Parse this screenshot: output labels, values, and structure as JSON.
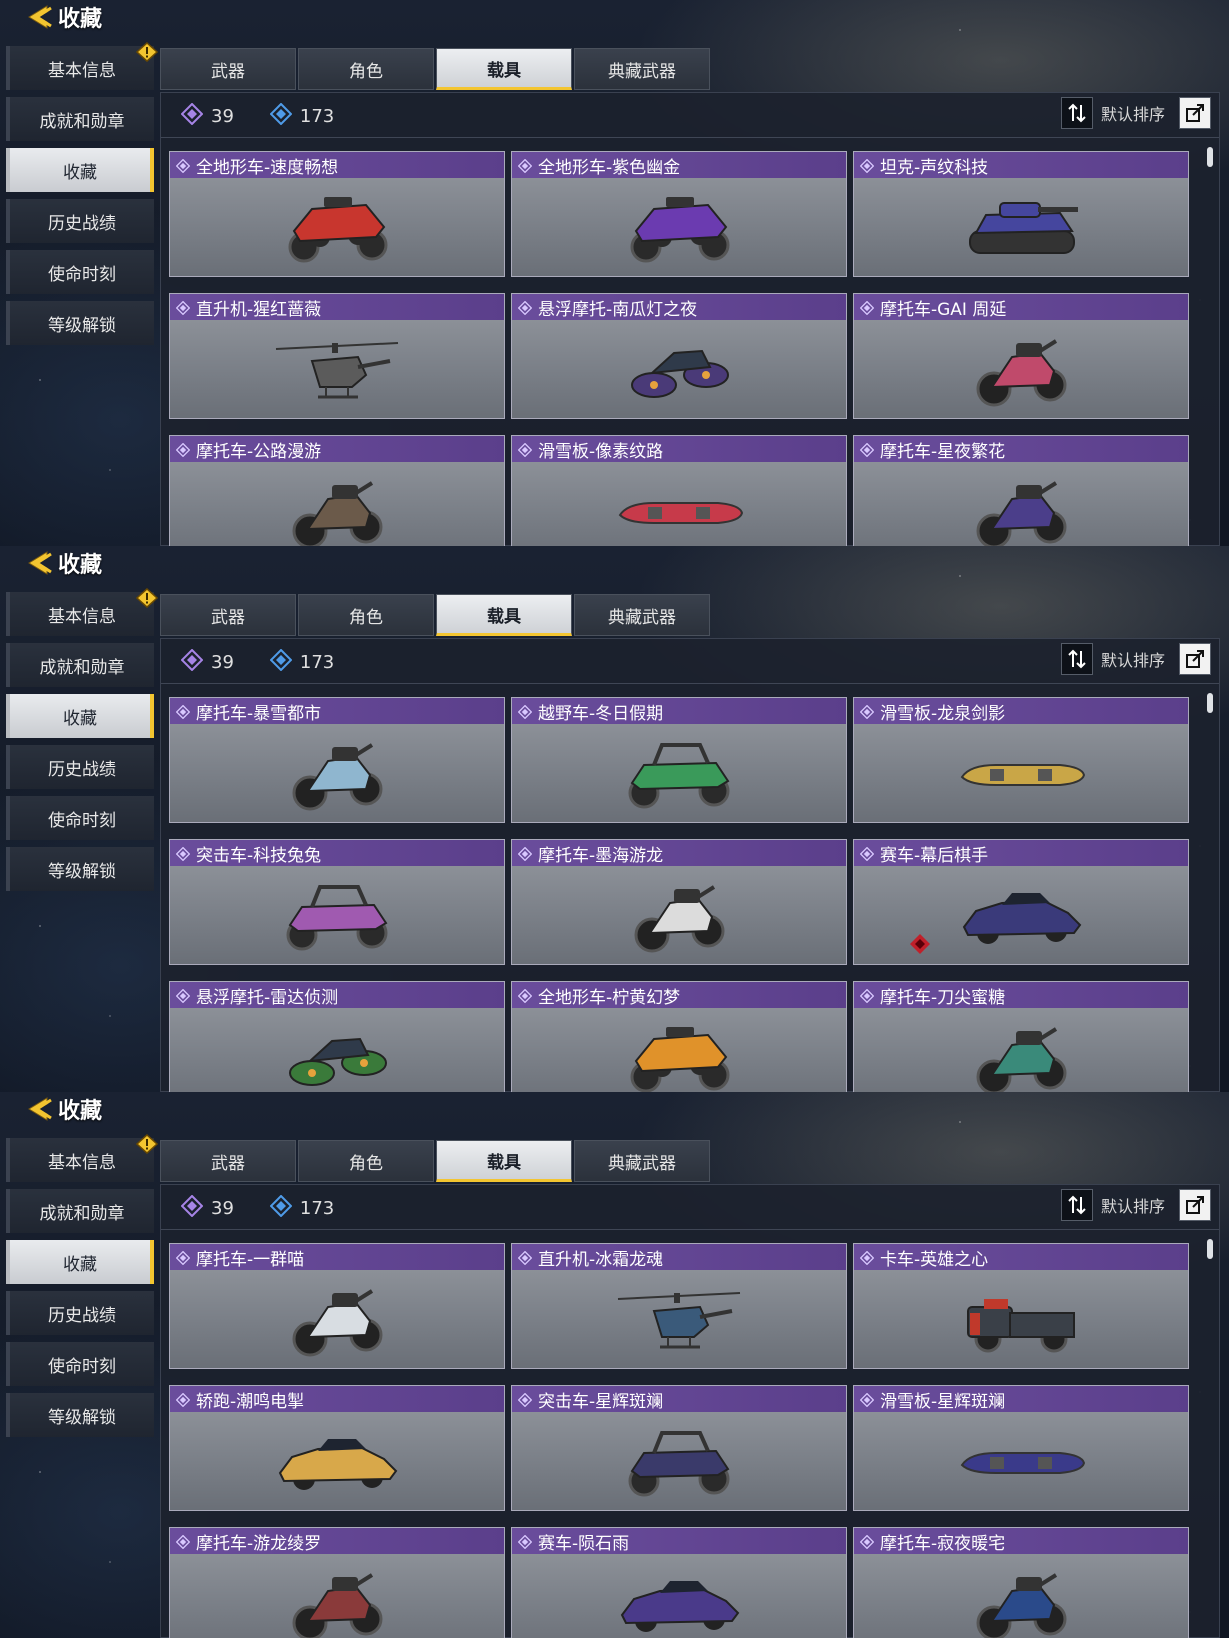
{
  "header": {
    "title": "收藏"
  },
  "sidebar": {
    "items": [
      {
        "label": "基本信息",
        "alert": true
      },
      {
        "label": "成就和勋章"
      },
      {
        "label": "收藏",
        "active": true
      },
      {
        "label": "历史战绩"
      },
      {
        "label": "使命时刻"
      },
      {
        "label": "等级解锁"
      }
    ]
  },
  "tabs": [
    {
      "label": "武器"
    },
    {
      "label": "角色"
    },
    {
      "label": "载具",
      "active": true
    },
    {
      "label": "典藏武器"
    }
  ],
  "stats": {
    "purple_count": "39",
    "blue_count": "173"
  },
  "sort": {
    "label": "默认排序"
  },
  "colors": {
    "accent": "#f3c530",
    "card_header": "#5b3f8b",
    "purple_gem": "#a684e6",
    "blue_gem": "#4f9be8"
  },
  "screens": [
    {
      "cards": [
        {
          "name": "全地形车-速度畅想",
          "vehicle": "atv-icon",
          "color": "#c8362e"
        },
        {
          "name": "全地形车-紫色幽金",
          "vehicle": "atv-icon",
          "color": "#6b3bb0"
        },
        {
          "name": "坦克-声纹科技",
          "vehicle": "tank-icon",
          "color": "#45469e"
        },
        {
          "name": "直升机-猩红蔷薇",
          "vehicle": "helicopter-icon",
          "color": "#5b5b5b"
        },
        {
          "name": "悬浮摩托-南瓜灯之夜",
          "vehicle": "hoverbike-icon",
          "color": "#4a3a78"
        },
        {
          "name": "摩托车-GAI 周延",
          "vehicle": "motorcycle-icon",
          "color": "#c04a6b"
        },
        {
          "name": "摩托车-公路漫游",
          "vehicle": "motorcycle-icon",
          "color": "#6b5a4a"
        },
        {
          "name": "滑雪板-像素纹路",
          "vehicle": "snowboard-icon",
          "color": "#c73a4a"
        },
        {
          "name": "摩托车-星夜繁花",
          "vehicle": "motorcycle-icon",
          "color": "#4b3e8a"
        }
      ]
    },
    {
      "cards": [
        {
          "name": "摩托车-暴雪都市",
          "vehicle": "motorcycle-icon",
          "color": "#8fb6cf"
        },
        {
          "name": "越野车-冬日假期",
          "vehicle": "buggy-icon",
          "color": "#3a9a5a"
        },
        {
          "name": "滑雪板-龙泉剑影",
          "vehicle": "snowboard-icon",
          "color": "#c9a647"
        },
        {
          "name": "突击车-科技兔兔",
          "vehicle": "buggy-icon",
          "color": "#a05ab0"
        },
        {
          "name": "摩托车-墨海游龙",
          "vehicle": "motorcycle-icon",
          "color": "#dcdcdc"
        },
        {
          "name": "赛车-幕后棋手",
          "vehicle": "car-icon",
          "color": "#3a3a7a",
          "mark": true
        },
        {
          "name": "悬浮摩托-雷达侦测",
          "vehicle": "hoverbike-icon",
          "color": "#3a7a3a"
        },
        {
          "name": "全地形车-柠黄幻梦",
          "vehicle": "atv-icon",
          "color": "#e0922a"
        },
        {
          "name": "摩托车-刀尖蜜糖",
          "vehicle": "motorcycle-icon",
          "color": "#3a8a7a"
        }
      ]
    },
    {
      "cards": [
        {
          "name": "摩托车-一群喵",
          "vehicle": "motorcycle-icon",
          "color": "#d8dde2"
        },
        {
          "name": "直升机-冰霜龙魂",
          "vehicle": "helicopter-icon",
          "color": "#3a5a7a"
        },
        {
          "name": "卡车-英雄之心",
          "vehicle": "truck-icon",
          "color": "#3a4048"
        },
        {
          "name": "轿跑-潮鸣电掣",
          "vehicle": "car-icon",
          "color": "#d8a84a"
        },
        {
          "name": "突击车-星辉斑斓",
          "vehicle": "buggy-icon",
          "color": "#3a3a6a"
        },
        {
          "name": "滑雪板-星辉斑斓",
          "vehicle": "snowboard-icon",
          "color": "#3a3a8a"
        },
        {
          "name": "摩托车-游龙绫罗",
          "vehicle": "motorcycle-icon",
          "color": "#8a3a3a"
        },
        {
          "name": "赛车-陨石雨",
          "vehicle": "car-icon",
          "color": "#4a3a8a"
        },
        {
          "name": "摩托车-寂夜暖宅",
          "vehicle": "motorcycle-icon",
          "color": "#2a4a8a"
        }
      ]
    }
  ]
}
